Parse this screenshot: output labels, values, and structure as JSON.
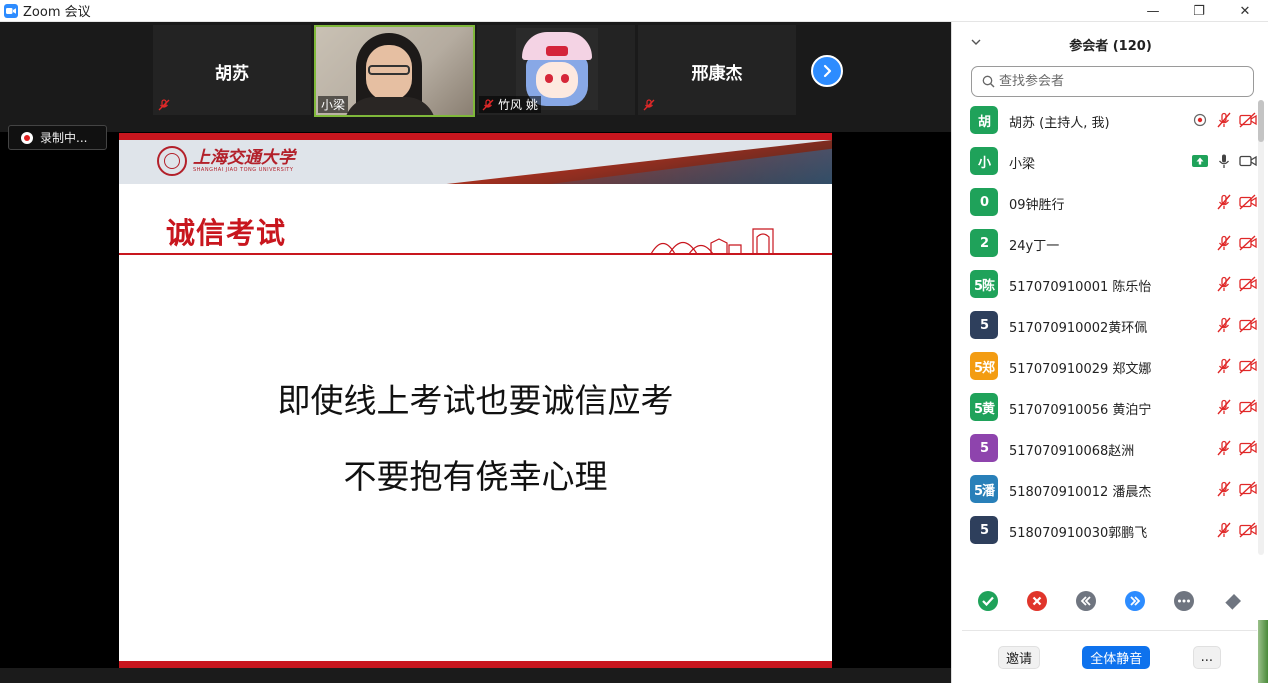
{
  "window": {
    "title": "Zoom 会议",
    "controls": {
      "minimize": "—",
      "maximize": "❐",
      "close": "✕"
    }
  },
  "video_strip": {
    "tiles": [
      {
        "big_name": "胡苏",
        "tag": "",
        "type": "avatar"
      },
      {
        "big_name": "",
        "tag": "小梁",
        "type": "camera"
      },
      {
        "big_name": "",
        "tag": "竹风 姚",
        "type": "picture"
      },
      {
        "big_name": "邢康杰",
        "tag": "",
        "type": "avatar"
      }
    ]
  },
  "recording": {
    "label": "录制中..."
  },
  "slide": {
    "university_cn": "上海交通大学",
    "university_en": "SHANGHAI JIAO TONG UNIVERSITY",
    "title": "诚信考试",
    "line1": "即使线上考试也要诚信应考",
    "line2": "不要抱有侥幸心理"
  },
  "participants": {
    "header": "参会者 (120)",
    "search_placeholder": "查找参会者",
    "list": [
      {
        "avatar": "胡",
        "color": "#1fa25a",
        "name": "胡苏 (主持人, 我)",
        "host": true,
        "share": false,
        "mic_on": false,
        "video_on": false
      },
      {
        "avatar": "小",
        "color": "#1fa25a",
        "name": "小梁",
        "host": false,
        "share": true,
        "mic_on": true,
        "video_on": true
      },
      {
        "avatar": "0",
        "color": "#1fa25a",
        "name": "09钟胜行",
        "host": false,
        "share": false,
        "mic_on": false,
        "video_on": false
      },
      {
        "avatar": "2",
        "color": "#1fa25a",
        "name": "24y丁一",
        "host": false,
        "share": false,
        "mic_on": false,
        "video_on": false
      },
      {
        "avatar": "5陈",
        "color": "#1fa25a",
        "name": "517070910001 陈乐怡",
        "host": false,
        "share": false,
        "mic_on": false,
        "video_on": false
      },
      {
        "avatar": "5",
        "color": "#2e3f5c",
        "name": "517070910002黄环佩",
        "host": false,
        "share": false,
        "mic_on": false,
        "video_on": false
      },
      {
        "avatar": "5郑",
        "color": "#f39c12",
        "name": "517070910029 郑文娜",
        "host": false,
        "share": false,
        "mic_on": false,
        "video_on": false
      },
      {
        "avatar": "5黄",
        "color": "#1fa25a",
        "name": "517070910056 黄泊宁",
        "host": false,
        "share": false,
        "mic_on": false,
        "video_on": false
      },
      {
        "avatar": "5",
        "color": "#8e44ad",
        "name": "517070910068赵洲",
        "host": false,
        "share": false,
        "mic_on": false,
        "video_on": false
      },
      {
        "avatar": "5潘",
        "color": "#2980b9",
        "name": "518070910012 潘晨杰",
        "host": false,
        "share": false,
        "mic_on": false,
        "video_on": false
      },
      {
        "avatar": "5",
        "color": "#2e3f5c",
        "name": "518070910030郭鹏飞",
        "host": false,
        "share": false,
        "mic_on": false,
        "video_on": false
      }
    ]
  },
  "reactions": [
    "check-icon",
    "x-icon",
    "rewind-icon",
    "fast-forward-icon",
    "more-icon",
    "eraser-icon"
  ],
  "footer": {
    "invite": "邀请",
    "mute_all": "全体静音",
    "more": "..."
  },
  "colors": {
    "zoom_blue": "#2d8cff",
    "sjtu_red": "#c8161e",
    "mute_red": "#e02828"
  }
}
